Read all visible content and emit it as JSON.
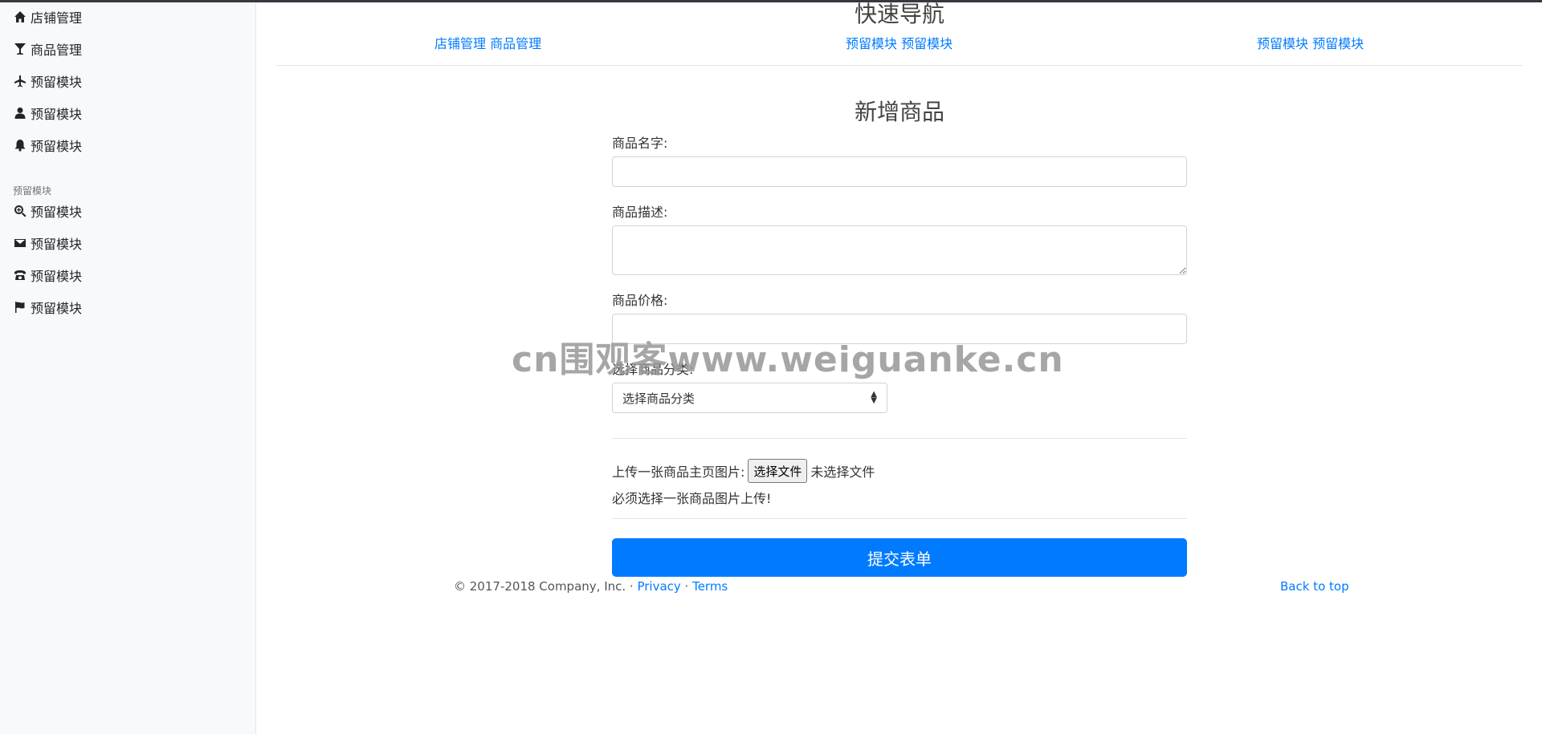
{
  "sidebar": {
    "items": [
      {
        "label": "店铺管理",
        "icon": "home-icon"
      },
      {
        "label": "商品管理",
        "icon": "glass-icon"
      },
      {
        "label": "预留模块",
        "icon": "plane-icon"
      },
      {
        "label": "预留模块",
        "icon": "user-icon"
      },
      {
        "label": "预留模块",
        "icon": "bell-icon"
      }
    ],
    "section_heading": "预留模块",
    "section_items": [
      {
        "label": "预留模块",
        "icon": "zoom-icon"
      },
      {
        "label": "预留模块",
        "icon": "envelope-icon"
      },
      {
        "label": "预留模块",
        "icon": "phone-icon"
      },
      {
        "label": "预留模块",
        "icon": "flag-icon"
      }
    ]
  },
  "nav": {
    "title": "快速导航",
    "groups": [
      {
        "a": "店铺管理",
        "b": "商品管理"
      },
      {
        "a": "预留模块",
        "b": "预留模块"
      },
      {
        "a": "预留模块",
        "b": "预留模块"
      }
    ]
  },
  "form": {
    "title": "新增商品",
    "name_label": "商品名字:",
    "name_value": "",
    "desc_label": "商品描述:",
    "desc_value": "",
    "price_label": "商品价格:",
    "price_value": "",
    "category_label": "选择商品分类:",
    "category_selected": "选择商品分类",
    "upload_label": "上传一张商品主页图片:",
    "file_button": "选择文件",
    "file_status": "未选择文件",
    "upload_note": "必须选择一张商品图片上传!",
    "submit_label": "提交表单"
  },
  "footer": {
    "copyright": "© 2017-2018 Company, Inc. · ",
    "privacy": "Privacy",
    "dot": " · ",
    "terms": "Terms",
    "back_to_top": "Back to top"
  },
  "watermark": "cn围观客www.weiguanke.cn",
  "colors": {
    "accent": "#007bff",
    "sidebar_bg": "#f8f9fa",
    "topbar": "#343a40"
  }
}
